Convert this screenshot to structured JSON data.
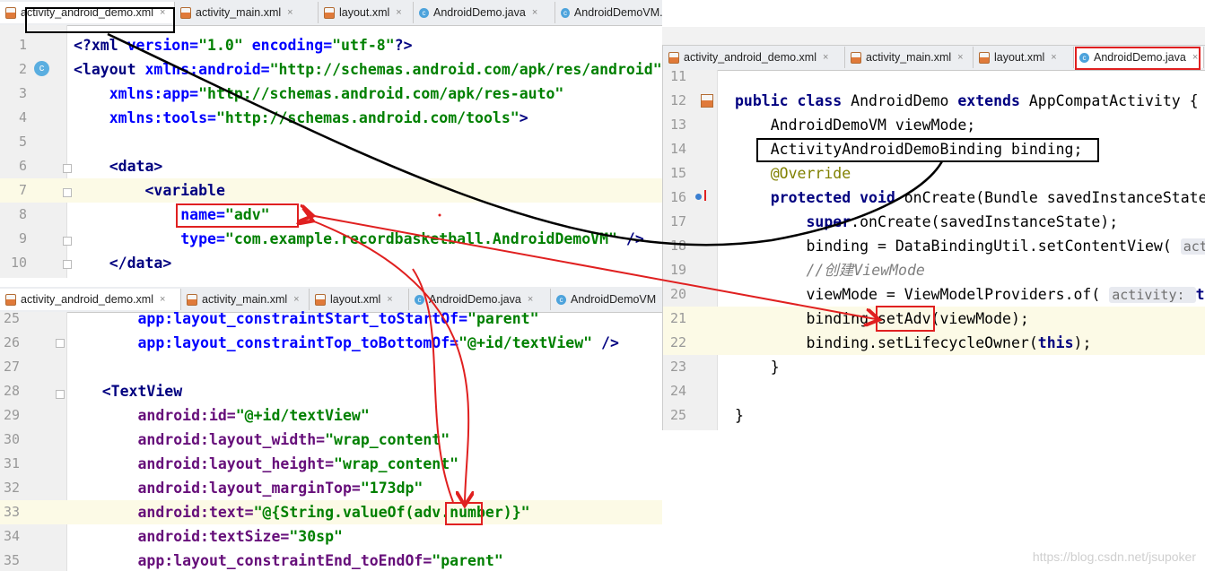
{
  "top_left": {
    "tabs": [
      {
        "label": "activity_android_demo.xml",
        "icon": "xml-file-icon"
      },
      {
        "label": "activity_main.xml",
        "icon": "xml-file-icon"
      },
      {
        "label": "layout.xml",
        "icon": "xml-file-icon"
      },
      {
        "label": "AndroidDemo.java",
        "icon": "java-class-icon"
      },
      {
        "label": "AndroidDemoVM.jav",
        "icon": "java-class-icon"
      }
    ],
    "lines": [
      {
        "n": "1",
        "p": [
          [
            "<?",
            "tag"
          ],
          [
            "xml ",
            "kw"
          ],
          [
            "version=",
            "att"
          ],
          [
            "\"1.0\" ",
            "str"
          ],
          [
            "encoding=",
            "att"
          ],
          [
            "\"utf-8\"",
            "str"
          ],
          [
            "?>",
            "tag"
          ]
        ]
      },
      {
        "n": "2",
        "p": [
          [
            "<layout ",
            "tag"
          ],
          [
            "xmlns:android=",
            "att"
          ],
          [
            "\"http://schemas.android.com/apk/res/android\"",
            "str"
          ]
        ]
      },
      {
        "n": "3",
        "p": [
          [
            "    xmlns:app=",
            "att"
          ],
          [
            "\"http://schemas.android.com/apk/res-auto\"",
            "str"
          ]
        ]
      },
      {
        "n": "4",
        "p": [
          [
            "    xmlns:tools=",
            "att"
          ],
          [
            "\"http://schemas.android.com/tools\"",
            "str"
          ],
          [
            ">",
            "tag"
          ]
        ]
      },
      {
        "n": "5",
        "p": []
      },
      {
        "n": "6",
        "p": [
          [
            "    <data>",
            "tag"
          ]
        ]
      },
      {
        "n": "7",
        "p": [
          [
            "        ",
            ""
          ],
          [
            "<variable",
            "tag"
          ]
        ]
      },
      {
        "n": "8",
        "p": [
          [
            "            ",
            ""
          ],
          [
            "name=",
            "att"
          ],
          [
            "\"adv\"",
            "str"
          ]
        ]
      },
      {
        "n": "9",
        "p": [
          [
            "            ",
            ""
          ],
          [
            "type=",
            "att"
          ],
          [
            "\"com.example.recordbasketball.AndroidDemoVM\" ",
            "str"
          ],
          [
            "/>",
            "tag"
          ]
        ]
      },
      {
        "n": "10",
        "p": [
          [
            "    </data>",
            "tag"
          ]
        ]
      }
    ]
  },
  "bottom_left": {
    "tabs": [
      {
        "label": "activity_android_demo.xml",
        "icon": "xml-file-icon"
      },
      {
        "label": "activity_main.xml",
        "icon": "xml-file-icon"
      },
      {
        "label": "layout.xml",
        "icon": "xml-file-icon"
      },
      {
        "label": "AndroidDemo.java",
        "icon": "java-class-icon"
      },
      {
        "label": "AndroidDemoVM",
        "icon": "java-class-icon"
      }
    ],
    "lines": [
      {
        "n": "25",
        "p": [
          [
            "        app:layout_constraintStart_toStartOf=",
            "att"
          ],
          [
            "\"parent\"",
            "str"
          ]
        ]
      },
      {
        "n": "26",
        "p": [
          [
            "        app:layout_constraintTop_toBottomOf=",
            "att"
          ],
          [
            "\"@+id/textView\" ",
            "str"
          ],
          [
            "/>",
            "tag"
          ]
        ]
      },
      {
        "n": "27",
        "p": []
      },
      {
        "n": "28",
        "p": [
          [
            "    <TextView",
            "tag"
          ]
        ]
      },
      {
        "n": "29",
        "p": [
          [
            "        android:id=",
            "purple"
          ],
          [
            "\"@+id/textView\"",
            "str"
          ]
        ]
      },
      {
        "n": "30",
        "p": [
          [
            "        android:layout_width=",
            "purple"
          ],
          [
            "\"wrap_content\"",
            "str"
          ]
        ]
      },
      {
        "n": "31",
        "p": [
          [
            "        android:layout_height=",
            "purple"
          ],
          [
            "\"wrap_content\"",
            "str"
          ]
        ]
      },
      {
        "n": "32",
        "p": [
          [
            "        android:layout_marginTop=",
            "purple"
          ],
          [
            "\"173dp\"",
            "str"
          ]
        ]
      },
      {
        "n": "33",
        "p": [
          [
            "        android:text=",
            "purple"
          ],
          [
            "\"@{String.valueOf(adv.number)}\"",
            "str"
          ]
        ]
      },
      {
        "n": "34",
        "p": [
          [
            "        android:textSize=",
            "purple"
          ],
          [
            "\"30sp\"",
            "str"
          ]
        ]
      },
      {
        "n": "35",
        "p": [
          [
            "        app:layout_constraintEnd_toEndOf=",
            "purple"
          ],
          [
            "\"parent\"",
            "str"
          ]
        ]
      }
    ]
  },
  "right": {
    "tabs": [
      {
        "label": "activity_android_demo.xml",
        "icon": "xml-file-icon"
      },
      {
        "label": "activity_main.xml",
        "icon": "xml-file-icon"
      },
      {
        "label": "layout.xml",
        "icon": "xml-file-icon"
      },
      {
        "label": "AndroidDemo.java",
        "icon": "java-class-icon"
      }
    ],
    "lines": [
      {
        "n": "11",
        "p": []
      },
      {
        "n": "12",
        "p": [
          [
            "public class ",
            "kw"
          ],
          [
            "AndroidDemo ",
            ""
          ],
          [
            "extends ",
            "kw"
          ],
          [
            "AppCompatActivity {",
            ""
          ]
        ]
      },
      {
        "n": "13",
        "p": [
          [
            "    AndroidDemoVM ",
            ""
          ],
          [
            "viewMode",
            ""
          ],
          [
            ";",
            ""
          ]
        ]
      },
      {
        "n": "14",
        "p": [
          [
            "    ActivityAndroidDemoBinding ",
            ""
          ],
          [
            "binding",
            ""
          ],
          [
            ";",
            ""
          ]
        ]
      },
      {
        "n": "15",
        "p": [
          [
            "    @Override",
            "ann"
          ]
        ]
      },
      {
        "n": "16",
        "p": [
          [
            "    protected void ",
            "kw"
          ],
          [
            "onCreate(Bundle savedInstanceState",
            ""
          ]
        ]
      },
      {
        "n": "17",
        "p": [
          [
            "        super",
            "kw"
          ],
          [
            ".onCreate(savedInstanceState);",
            ""
          ]
        ]
      },
      {
        "n": "18",
        "p": [
          [
            "        binding",
            ""
          ],
          [
            " = DataBindingUtil.",
            ""
          ],
          [
            "setContentView",
            ""
          ],
          [
            "( ",
            ""
          ],
          [
            "acti",
            "hint"
          ]
        ]
      },
      {
        "n": "19",
        "p": [
          [
            "        //创建ViewMode",
            "com"
          ]
        ]
      },
      {
        "n": "20",
        "p": [
          [
            "        viewMode",
            ""
          ],
          [
            " = ViewModelProviders.",
            ""
          ],
          [
            "of",
            ""
          ],
          [
            "( ",
            ""
          ],
          [
            "activity: ",
            "hint"
          ],
          [
            "this",
            "kw"
          ]
        ]
      },
      {
        "n": "21",
        "p": [
          [
            "        binding",
            ""
          ],
          [
            ".setAdv(viewMode);",
            ""
          ]
        ]
      },
      {
        "n": "22",
        "p": [
          [
            "        binding",
            ""
          ],
          [
            ".setLifecycleOwner(",
            ""
          ],
          [
            "this",
            "kw"
          ],
          [
            ");",
            ""
          ]
        ]
      },
      {
        "n": "23",
        "p": [
          [
            "    }",
            ""
          ]
        ]
      },
      {
        "n": "24",
        "p": []
      },
      {
        "n": "25",
        "p": [
          [
            "}",
            ""
          ]
        ]
      }
    ]
  },
  "watermark": "https://blog.csdn.net/jsupoker"
}
